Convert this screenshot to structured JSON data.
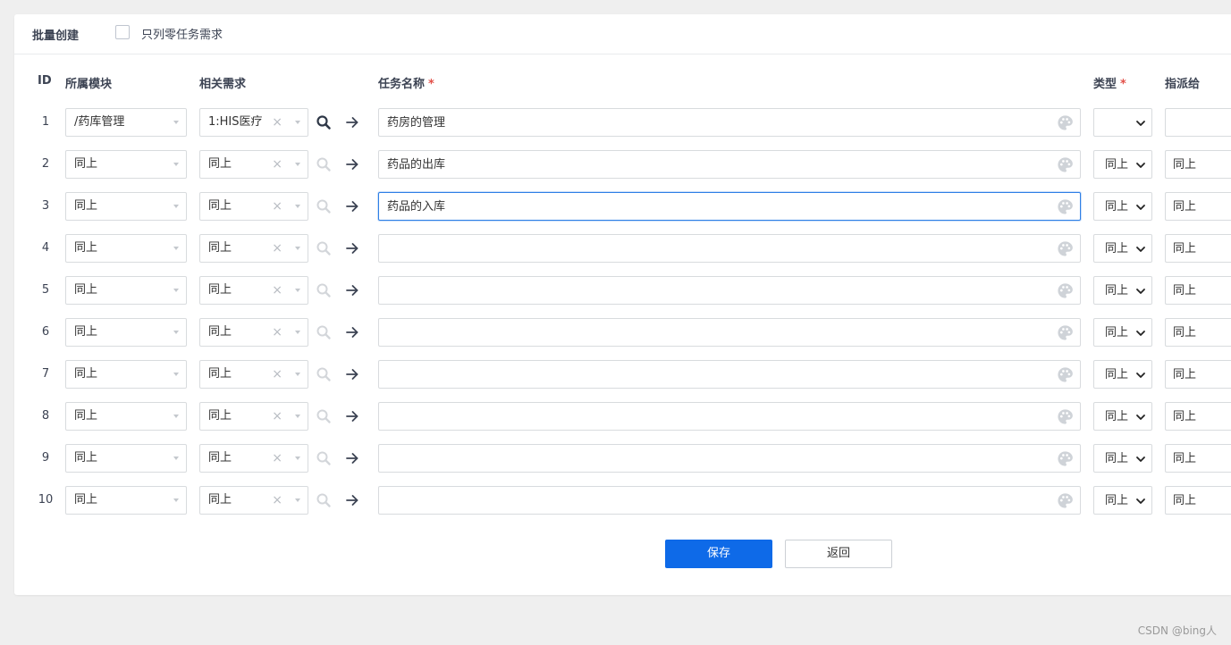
{
  "header": {
    "title": "批量创建",
    "only_zero_task_label": "只列零任务需求"
  },
  "columns": {
    "id": "ID",
    "module": "所属模块",
    "story": "相关需求",
    "name": "任务名称",
    "type": "类型",
    "assign": "指派给",
    "required_mark": "*"
  },
  "rows": [
    {
      "id": "1",
      "module": "/药库管理",
      "story": "1:HIS医疗",
      "name": "药房的管理",
      "type": "",
      "assign": ""
    },
    {
      "id": "2",
      "module": "同上",
      "story": "同上",
      "name": "药品的出库",
      "type": "同上",
      "assign": "同上"
    },
    {
      "id": "3",
      "module": "同上",
      "story": "同上",
      "name": "药品的入库",
      "type": "同上",
      "assign": "同上"
    },
    {
      "id": "4",
      "module": "同上",
      "story": "同上",
      "name": "",
      "type": "同上",
      "assign": "同上"
    },
    {
      "id": "5",
      "module": "同上",
      "story": "同上",
      "name": "",
      "type": "同上",
      "assign": "同上"
    },
    {
      "id": "6",
      "module": "同上",
      "story": "同上",
      "name": "",
      "type": "同上",
      "assign": "同上"
    },
    {
      "id": "7",
      "module": "同上",
      "story": "同上",
      "name": "",
      "type": "同上",
      "assign": "同上"
    },
    {
      "id": "8",
      "module": "同上",
      "story": "同上",
      "name": "",
      "type": "同上",
      "assign": "同上"
    },
    {
      "id": "9",
      "module": "同上",
      "story": "同上",
      "name": "",
      "type": "同上",
      "assign": "同上"
    },
    {
      "id": "10",
      "module": "同上",
      "story": "同上",
      "name": "",
      "type": "同上",
      "assign": "同上"
    }
  ],
  "buttons": {
    "save": "保存",
    "back": "返回"
  },
  "watermark": "CSDN @bing人",
  "colors": {
    "primary": "#0e6ae8",
    "required": "#e24f48",
    "focus_border": "#2e7fe6"
  }
}
